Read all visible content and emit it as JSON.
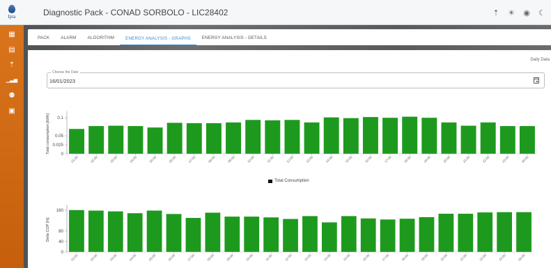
{
  "app": {
    "logo_text": "Ipta",
    "title": "Diagnostic Pack - CONAD SORBOLO - LIC28402"
  },
  "top_icons": [
    "signal-icon",
    "sun-icon",
    "toggle-icon",
    "moon-icon"
  ],
  "sidebar": {
    "items": [
      {
        "icon": "dashboard-icon",
        "glyph": "▦"
      },
      {
        "icon": "store-icon",
        "glyph": "▤"
      },
      {
        "icon": "signal-icon",
        "glyph": "⌕"
      },
      {
        "icon": "bar-chart-icon",
        "glyph": "▁▃▅"
      },
      {
        "icon": "users-icon",
        "glyph": "●"
      },
      {
        "icon": "calendar-search-icon",
        "glyph": "▣"
      }
    ]
  },
  "tabs": [
    {
      "label": "PACK",
      "active": false
    },
    {
      "label": "ALARM",
      "active": false
    },
    {
      "label": "ALGORITHM",
      "active": false
    },
    {
      "label": "ENERGY ANALYSIS - GRAPHS",
      "active": true
    },
    {
      "label": "ENERGY ANALYSIS - DETAILS",
      "active": false
    }
  ],
  "daily_link": "Daily Data",
  "date_picker": {
    "label": "Choose the Date",
    "value": "16/01/2023"
  },
  "colors": {
    "bar": "#1d9a1d",
    "accent": "#3b8ad9",
    "sidebar": "#d56b17"
  },
  "chart_data": [
    {
      "type": "bar",
      "ylabel": "Total consumption [kWh]",
      "ylim": [
        0,
        0.11
      ],
      "yticks": [
        0,
        0.025,
        0.05,
        0.1
      ],
      "legend": "Total Consumption",
      "categories": [
        "01:00",
        "02:00",
        "03:00",
        "04:00",
        "05:00",
        "06:00",
        "07:00",
        "08:00",
        "09:00",
        "10:00",
        "11:00",
        "12:00",
        "13:00",
        "14:00",
        "15:00",
        "16:00",
        "17:00",
        "18:00",
        "19:00",
        "20:00",
        "21:00",
        "22:00",
        "23:00",
        "00:00"
      ],
      "values": [
        0.069,
        0.077,
        0.078,
        0.077,
        0.073,
        0.086,
        0.085,
        0.085,
        0.087,
        0.094,
        0.093,
        0.094,
        0.087,
        0.101,
        0.099,
        0.102,
        0.1,
        0.103,
        0.1,
        0.087,
        0.078,
        0.087,
        0.077,
        0.077
      ]
    },
    {
      "type": "bar",
      "ylabel": "Delta COP [%]",
      "ylim": [
        0,
        170
      ],
      "yticks": [
        0,
        40,
        80,
        160
      ],
      "categories": [
        "01:00",
        "02:00",
        "03:00",
        "04:00",
        "05:00",
        "06:00",
        "07:00",
        "08:00",
        "09:00",
        "10:00",
        "11:00",
        "12:00",
        "13:00",
        "14:00",
        "15:00",
        "16:00",
        "17:00",
        "18:00",
        "19:00",
        "20:00",
        "21:00",
        "22:00",
        "23:00",
        "00:00"
      ],
      "values": [
        160,
        158,
        155,
        148,
        158,
        145,
        130,
        150,
        135,
        135,
        132,
        126,
        137,
        113,
        137,
        128,
        124,
        127,
        133,
        146,
        146,
        151,
        152,
        152
      ]
    }
  ]
}
